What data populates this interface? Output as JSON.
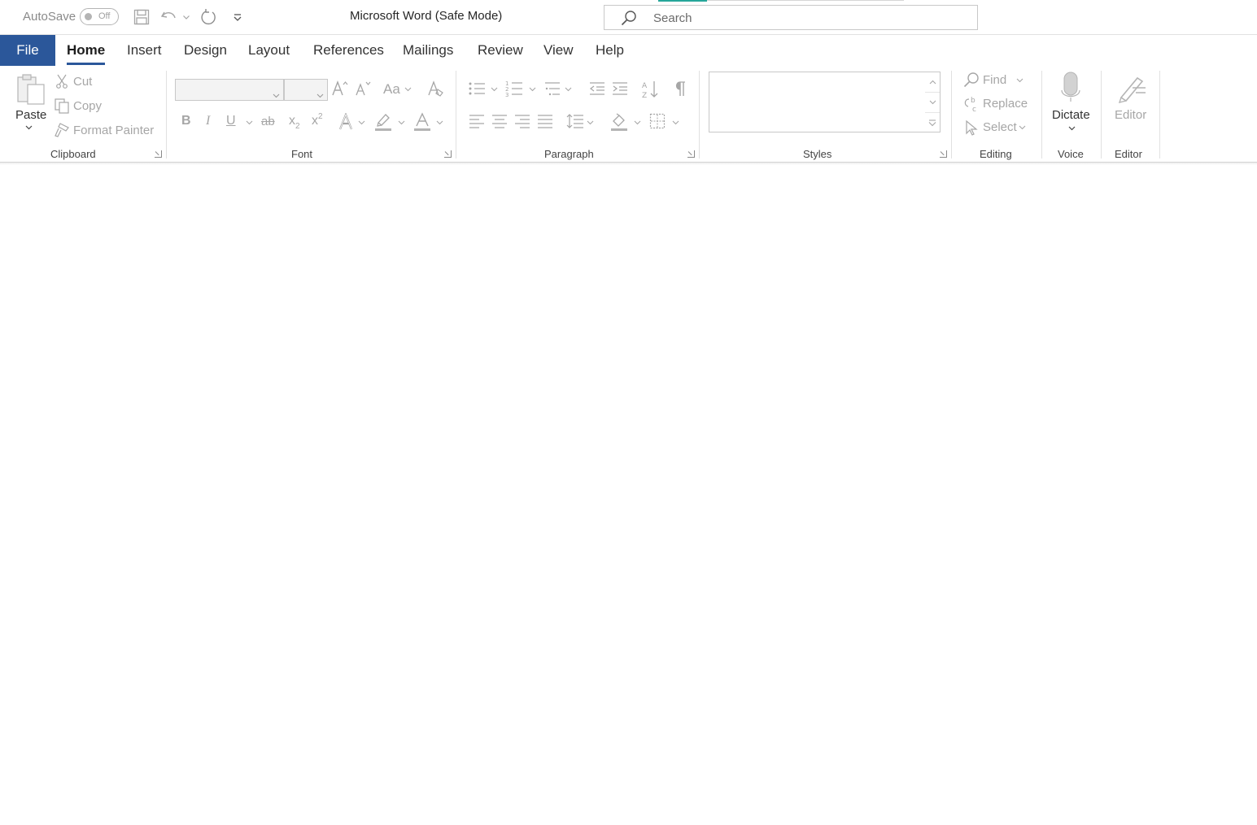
{
  "titlebar": {
    "autosave_label": "AutoSave",
    "autosave_state": "Off",
    "window_title": "Microsoft Word (Safe Mode)",
    "search_placeholder": "Search"
  },
  "tabs": {
    "file": "File",
    "home": "Home",
    "insert": "Insert",
    "design": "Design",
    "layout": "Layout",
    "references": "References",
    "mailings": "Mailings",
    "review": "Review",
    "view": "View",
    "help": "Help"
  },
  "clipboard": {
    "paste": "Paste",
    "cut": "Cut",
    "copy": "Copy",
    "format_painter": "Format Painter",
    "label": "Clipboard"
  },
  "font": {
    "label": "Font",
    "change_case": "Aa",
    "bold": "B",
    "italic": "I",
    "underline": "U",
    "strikethrough": "ab",
    "subscript": "x",
    "superscript": "x"
  },
  "paragraph": {
    "label": "Paragraph"
  },
  "styles": {
    "label": "Styles"
  },
  "editing": {
    "find": "Find",
    "replace": "Replace",
    "select": "Select",
    "label": "Editing"
  },
  "voice": {
    "dictate": "Dictate",
    "label": "Voice"
  },
  "editor": {
    "editor": "Editor",
    "label": "Editor"
  },
  "colors": {
    "file_tab": "#2b579a",
    "disabled_text": "#a6a6a6"
  }
}
